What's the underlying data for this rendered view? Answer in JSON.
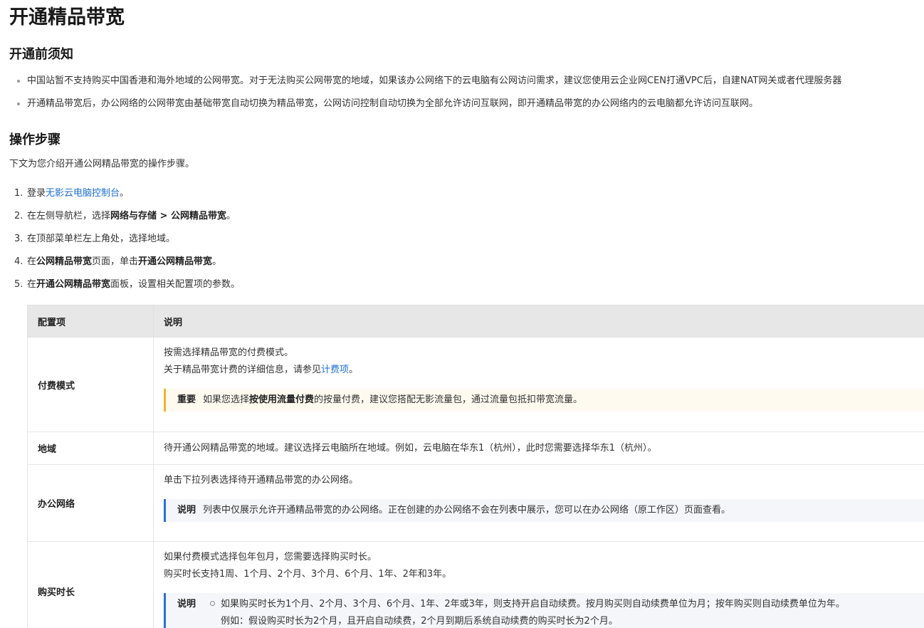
{
  "page_title": "开通精品带宽",
  "section_notice": {
    "heading": "开通前须知",
    "items": [
      "中国站暂不支持购买中国香港和海外地域的公网带宽。对于无法购买公网带宽的地域，如果该办公网络下的云电脑有公网访问需求，建议您使用云企业网CEN打通VPC后，自建NAT网关或者代理服务器",
      "开通精品带宽后，办公网络的公网带宽由基础带宽自动切换为精品带宽，公网访问控制自动切换为全部允许访问互联网，即开通精品带宽的办公网络内的云电脑都允许访问互联网。"
    ]
  },
  "section_steps": {
    "heading": "操作步骤",
    "intro": "下文为您介绍开通公网精品带宽的操作步骤。",
    "steps": [
      {
        "num": "1.",
        "pre": "登录",
        "link": "无影云电脑控制台",
        "post": "。"
      },
      {
        "num": "2.",
        "pre": "在左侧导航栏，选择",
        "bold1": "网络与存储 > 公网精品带宽",
        "post": "。"
      },
      {
        "num": "3.",
        "text": "在顶部菜单栏左上角处，选择地域。"
      },
      {
        "num": "4.",
        "pre": "在",
        "bold1": "公网精品带宽",
        "mid": "页面，单击",
        "bold2": "开通公网精品带宽",
        "post": "。"
      },
      {
        "num": "5.",
        "pre": "在",
        "bold1": "开通公网精品带宽",
        "mid": "面板，设置相关配置项的参数。"
      }
    ]
  },
  "table": {
    "headers": [
      "配置项",
      "说明"
    ],
    "rows": {
      "billing": {
        "key": "付费模式",
        "line1": "按需选择精品带宽的付费模式。",
        "line2_pre": "关于精品带宽计费的详细信息，请参见",
        "line2_link": "计费项",
        "line2_post": "。",
        "note_label": "重要",
        "note_pre": "如果您选择",
        "note_bold": "按使用流量付费",
        "note_post": "的按量付费，建议您搭配无影流量包，通过流量包抵扣带宽流量。"
      },
      "region": {
        "key": "地域",
        "line1": "待开通公网精品带宽的地域。建议选择云电脑所在地域。例如，云电脑在华东1（杭州），此时您需要选择华东1（杭州）。"
      },
      "network": {
        "key": "办公网络",
        "line1": "单击下拉列表选择待开通精品带宽的办公网络。",
        "note_label": "说明",
        "note_text": "列表中仅展示允许开通精品带宽的办公网络。正在创建的办公网络不会在列表中展示，您可以在办公网络（原工作区）页面查看。"
      },
      "duration": {
        "key": "购买时长",
        "line1": "如果付费模式选择包年包月，您需要选择购买时长。",
        "line2": "购买时长支持1周、1个月、2个月、3个月、6个月、1年、2年和3年。",
        "note_label": "说明",
        "note_item1": "如果购买时长为1个月、2个月、3个月、6个月、1年、2年或3年，则支持开启自动续费。按月购买则自动续费单位为月；按年购买则自动续费单位为年。",
        "note_item1_cont": "例如：假设购买时长为2个月，且开启自动续费，2个月到期后系统自动续费的购买时长为2个月。"
      }
    }
  }
}
